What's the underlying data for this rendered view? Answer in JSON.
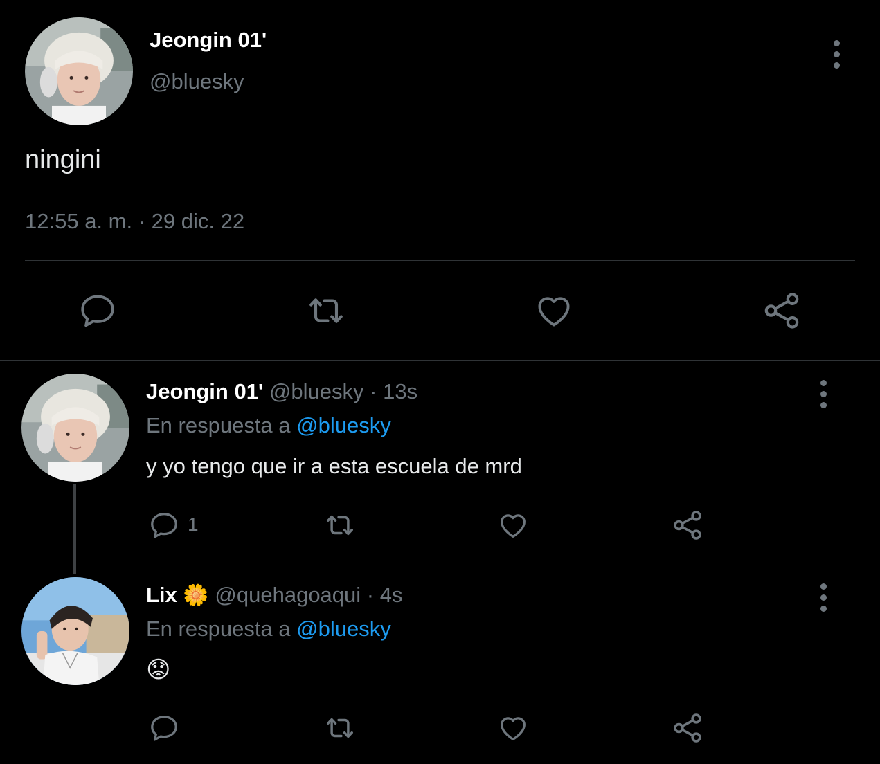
{
  "main_tweet": {
    "display_name": "Jeongin 01'",
    "handle": "@bluesky",
    "text": "ningini",
    "timestamp": "12:55 a. m. · 29 dic. 22"
  },
  "replies": [
    {
      "display_name": "Jeongin 01'",
      "handle": "@bluesky",
      "time": "· 13s",
      "reply_prefix": "En respuesta a",
      "reply_to": "@bluesky",
      "text": "y yo tengo que ir a esta escuela de mrd",
      "reply_count": "1"
    },
    {
      "display_name": "Lix",
      "name_emoji": "🌼",
      "handle": "@quehagoaqui",
      "time": "· 4s",
      "reply_prefix": "En respuesta a",
      "reply_to": "@bluesky",
      "text": "😟"
    }
  ],
  "colors": {
    "background": "#000000",
    "text": "#e7e9ea",
    "muted": "#6e767d",
    "link": "#1d9bf0",
    "divider": "#2f3336"
  },
  "icons": [
    "avatar",
    "more-options-icon",
    "reply-icon",
    "retweet-icon",
    "like-icon",
    "share-icon"
  ]
}
